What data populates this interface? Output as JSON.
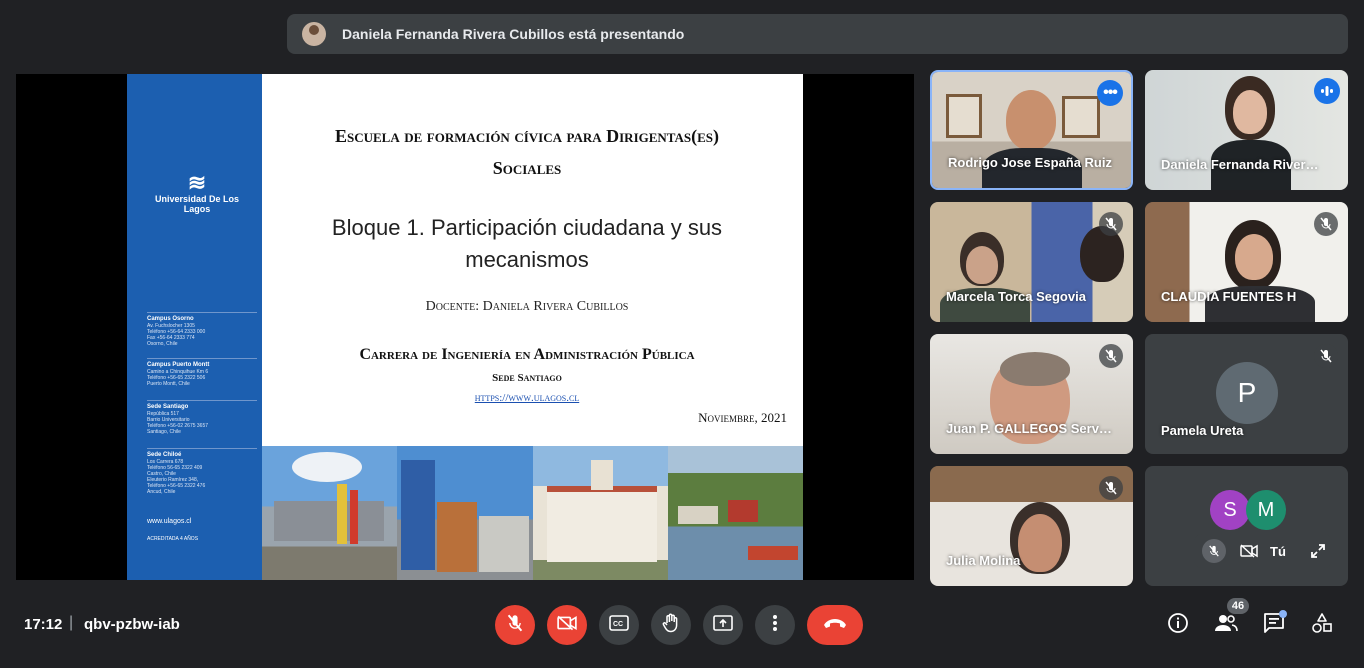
{
  "banner": {
    "text": "Daniela Fernanda Rivera Cubillos está presentando"
  },
  "slide": {
    "title_line1": "Escuela de formación cívica para Dirigentas(es)",
    "title_line2": "Sociales",
    "block_line1": "Bloque 1. Participación ciudadana y sus",
    "block_line2": "mecanismos",
    "docente": "Docente: Daniela Rivera Cubillos",
    "career": "Carrera de Ingeniería en Administración Pública",
    "sede": "Sede Santiago",
    "url": "https://www.ulagos.cl",
    "date": "Noviembre, 2021",
    "university": "Universidad De Los Lagos",
    "sidebar_link": "www.ulagos.cl",
    "campuses": [
      {
        "name": "Campus Osorno",
        "lines": [
          "Av. Fuchslocher 1305",
          "Teléfono +56-64 2333 000",
          "Fax +56-64 2333 774",
          "Osorno, Chile"
        ]
      },
      {
        "name": "Campus Puerto Montt",
        "lines": [
          "Camino a Chinquihue Km 6",
          "Teléfono +56-65 2322 506",
          "Puerto Montt, Chile"
        ]
      },
      {
        "name": "Sede Santiago",
        "lines": [
          "República 517",
          "Barrio Universitario",
          "Teléfono +56-02 2675 3657",
          "Santiago, Chile"
        ]
      },
      {
        "name": "Sede Chiloé",
        "lines": [
          "Los Carrera 678",
          "Teléfono 56-65 2322 409",
          "Castro, Chile",
          "Eleuterio Ramírez 348,",
          "Teléfono +56-65 2322 476",
          "Ancud, Chile"
        ]
      }
    ],
    "accreditation": "ACREDITADA 4 AÑOS"
  },
  "participants": [
    {
      "name": "Rodrigo Jose España Ruiz",
      "state": "speaking-menu"
    },
    {
      "name": "Daniela Fernanda River…",
      "state": "speaking"
    },
    {
      "name": "Marcela Torca Segovia",
      "state": "muted"
    },
    {
      "name": "CLAUDIA FUENTES H",
      "state": "muted"
    },
    {
      "name": "Juan P. GALLEGOS Serv…",
      "state": "muted"
    },
    {
      "name": "Pamela Ureta",
      "state": "muted",
      "avatar_letter": "P"
    },
    {
      "name": "Julia Molina",
      "state": "muted"
    }
  ],
  "self_tile": {
    "avatars": [
      "S",
      "M"
    ],
    "you_label": "Tú"
  },
  "bottom": {
    "time": "17:12",
    "separator": "|",
    "meeting_code": "qbv-pzbw-iab",
    "people_count": "46"
  },
  "colors": {
    "background": "#202124",
    "surface": "#3c4043",
    "danger": "#ea4335",
    "accent": "#1a73e8",
    "slide_blue": "#1c5fb0"
  },
  "icons": [
    "mic-off-icon",
    "camera-off-icon",
    "captions-icon",
    "raise-hand-icon",
    "present-icon",
    "more-options-icon",
    "end-call-icon",
    "info-icon",
    "people-icon",
    "chat-icon",
    "activities-icon"
  ]
}
